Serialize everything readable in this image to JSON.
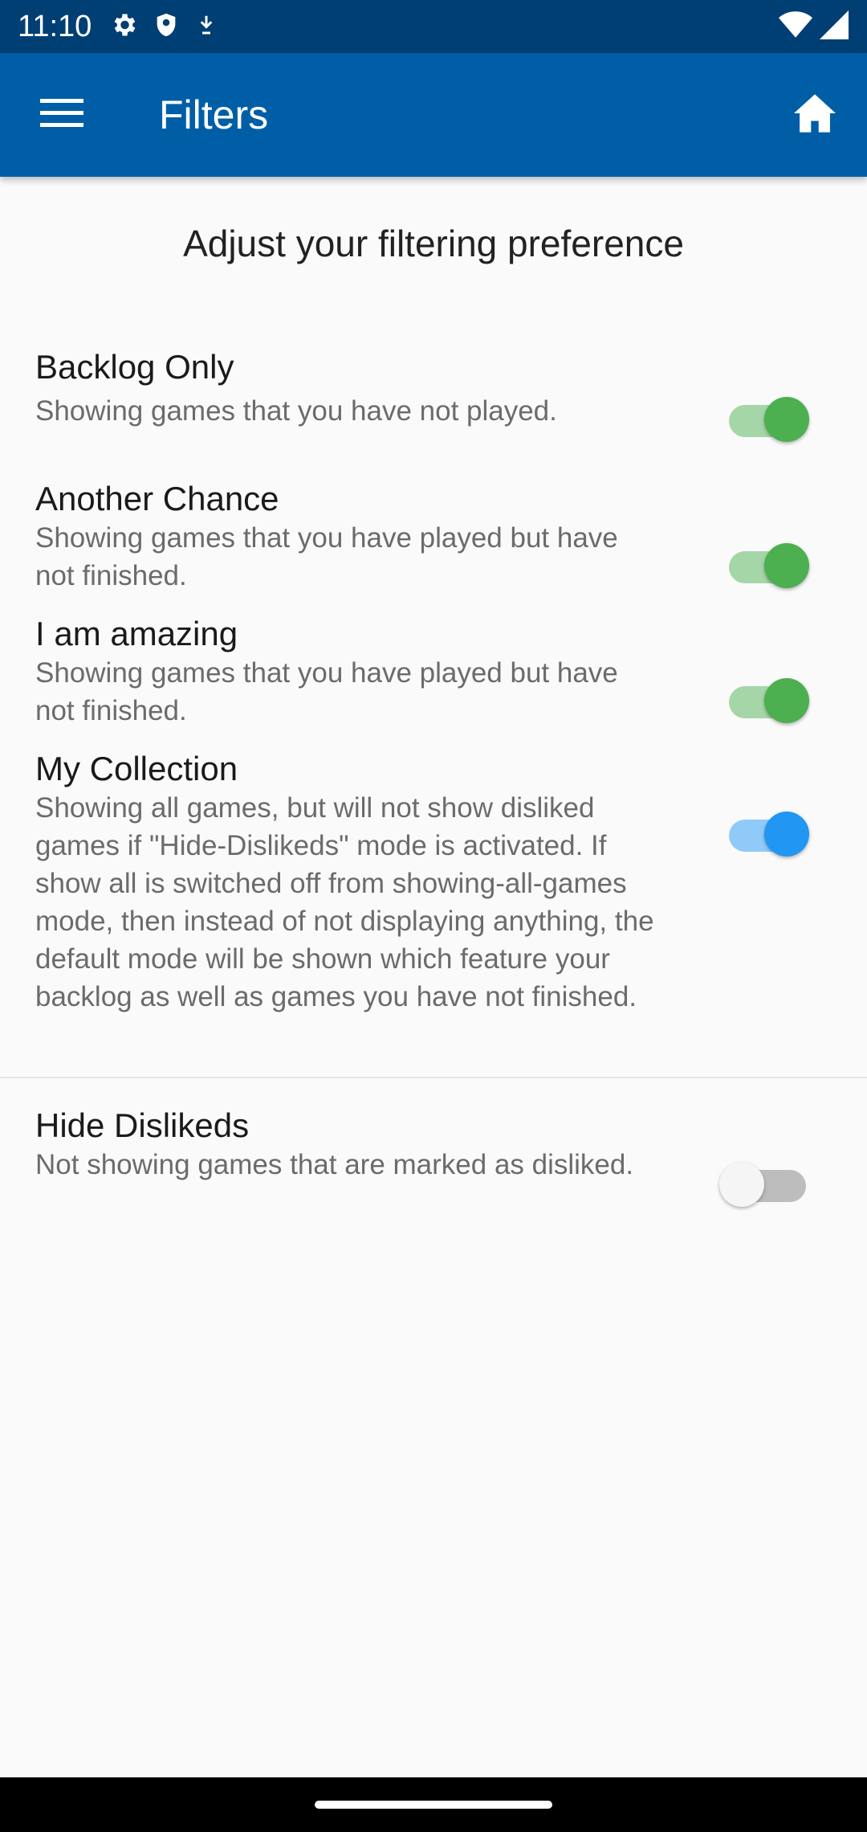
{
  "status_bar": {
    "time": "11:10",
    "icons": [
      "gear-icon",
      "shield-icon",
      "download-icon",
      "wifi-icon",
      "signal-icon"
    ]
  },
  "app_bar": {
    "title": "Filters",
    "menu_icon": "hamburger-menu-icon",
    "home_icon": "home-icon",
    "color": "#005ea6"
  },
  "page": {
    "heading": "Adjust your filtering preference"
  },
  "filters": [
    {
      "title": "Backlog Only",
      "description": "Showing games that you have not played.",
      "enabled": true,
      "accent": "#4caf50"
    },
    {
      "title": "Another Chance",
      "description": "Showing games that you have played but have not finished.",
      "enabled": true,
      "accent": "#4caf50"
    },
    {
      "title": "I am amazing",
      "description": "Showing games that you have played but have not finished.",
      "enabled": true,
      "accent": "#4caf50"
    },
    {
      "title": "My Collection",
      "description": "Showing all games, but will not show disliked games if \"Hide-Dislikeds\" mode is activated. If show all is switched off from showing-all-games mode, then instead of not displaying anything, the default mode will be shown which feature your backlog as well as games you have not finished.",
      "enabled": true,
      "accent": "#2196f3"
    },
    {
      "title": "Hide Dislikeds",
      "description": "Not showing games that are marked as disliked.",
      "enabled": false,
      "accent": "#bdbdbd"
    }
  ]
}
